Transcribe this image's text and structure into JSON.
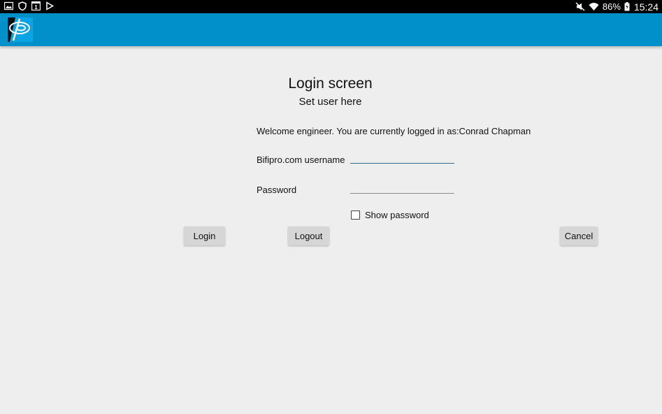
{
  "status_bar": {
    "left_icons": [
      "image-icon",
      "shield-icon",
      "calendar-icon",
      "play-store-icon"
    ],
    "calendar_day": "1",
    "battery_percent": "86%",
    "time": "15:24"
  },
  "app_bar": {
    "brand_color": "#0190c9"
  },
  "login": {
    "title": "Login screen",
    "subtitle": "Set user here",
    "welcome": "Welcome engineer. You are currently logged in as:Conrad Chapman",
    "username_label": "Bifipro.com username",
    "username_value": "",
    "password_label": "Password",
    "password_value": "",
    "show_password_label": "Show password",
    "show_password_checked": false
  },
  "buttons": {
    "login": "Login",
    "logout": "Logout",
    "cancel": "Cancel"
  }
}
